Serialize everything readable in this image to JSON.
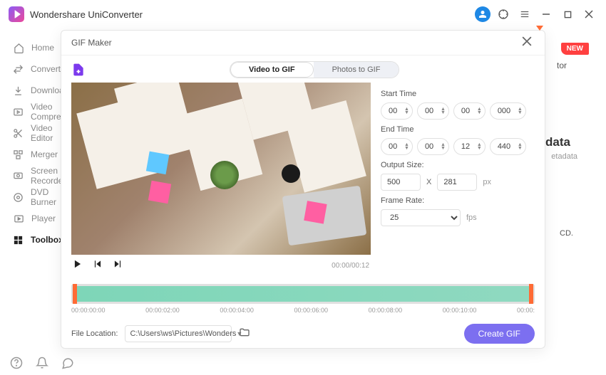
{
  "app": {
    "title": "Wondershare UniConverter"
  },
  "sidebar": {
    "items": [
      {
        "label": "Home"
      },
      {
        "label": "Converter"
      },
      {
        "label": "Downloader"
      },
      {
        "label": "Video Compressor"
      },
      {
        "label": "Video Editor"
      },
      {
        "label": "Merger"
      },
      {
        "label": "Screen Recorder"
      },
      {
        "label": "DVD Burner"
      },
      {
        "label": "Player"
      },
      {
        "label": "Toolbox"
      }
    ]
  },
  "badges": {
    "new": "NEW"
  },
  "bg": {
    "tor": "tor",
    "data": "data",
    "etadata": "etadata",
    "cd": "CD."
  },
  "modal": {
    "title": "GIF Maker",
    "tabs": {
      "video": "Video to GIF",
      "photos": "Photos to GIF"
    },
    "time_display": "00:00/00:12",
    "start_label": "Start Time",
    "end_label": "End Time",
    "start": {
      "hh": "00",
      "mm": "00",
      "ss": "00",
      "ms": "000"
    },
    "end": {
      "hh": "00",
      "mm": "00",
      "ss": "12",
      "ms": "440"
    },
    "output_label": "Output Size:",
    "output": {
      "w": "500",
      "h": "281",
      "unit": "px"
    },
    "x_sep": "X",
    "frame_label": "Frame Rate:",
    "frame": {
      "value": "25",
      "unit": "fps"
    },
    "ticks": [
      "00:00:00:00",
      "00:00:02:00",
      "00:00:04:00",
      "00:00:06:00",
      "00:00:08:00",
      "00:00:10:00",
      "00:00:"
    ],
    "file_label": "File Location:",
    "file_path": "C:\\Users\\ws\\Pictures\\Wonders",
    "create": "Create GIF"
  }
}
